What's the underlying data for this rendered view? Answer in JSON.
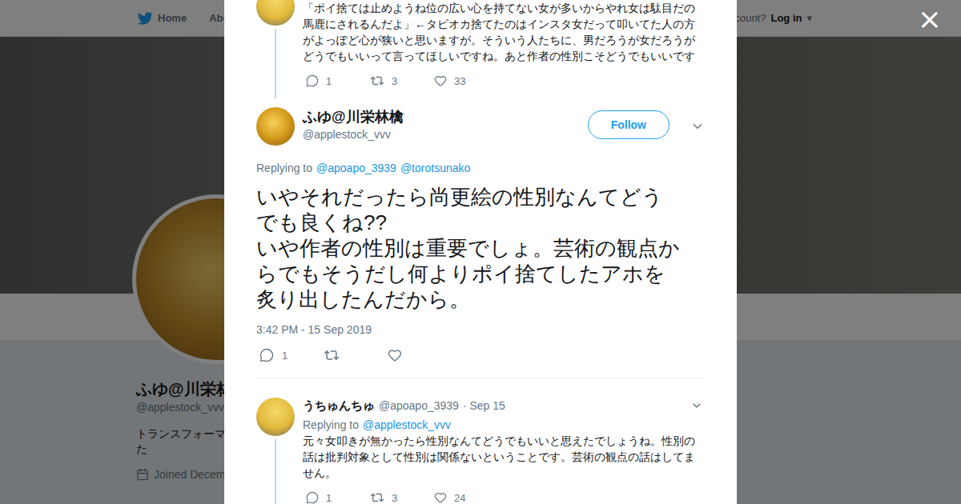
{
  "nav": {
    "items": [
      "Home",
      "Abo"
    ],
    "account": "ccount?",
    "login": "Log in",
    "login_caret": "▾"
  },
  "close": "×",
  "profile": {
    "name": "ふゆ@川栄林",
    "handle": "@applestock_vvv",
    "bio": [
      "トランスフォーマ",
      "た"
    ],
    "joined": "Joined Decem"
  },
  "tweets": [
    {
      "kind": "context",
      "thread": true,
      "text": [
        "「ポイ捨ては止めようね位の広い心を持てない女が多いからやれ女は駄目だの",
        "馬鹿にされるんだよ」←タピオカ捨てたのはインスタ女だって叩いてた人の方",
        "がよっぽど心が狭いと思いますが。そういう人たちに、男だろうが女だろうが",
        "どうでもいいって言ってほしいですね。あと作者の性別こそどうでもいいです"
      ],
      "replies": "1",
      "retweets": "3",
      "likes": "33"
    },
    {
      "kind": "focus",
      "thread": false,
      "name": "ふゆ@川栄林檎",
      "handle": "@applestock_vvv",
      "follow": "Follow",
      "replying_label": "Replying to",
      "replying_to": [
        "@apoapo_3939",
        "@torotsunako"
      ],
      "text": [
        "いやそれだったら尚更絵の性別なんてどう",
        "でも良くね??",
        "いや作者の性別は重要でしょ。芸術の観点か",
        "らでもそうだし何よりポイ捨てしたアホを",
        "炙り出したんだから。"
      ],
      "timestamp": "3:42 PM - 15 Sep 2019",
      "replies": "1",
      "retweets": "",
      "likes": ""
    },
    {
      "kind": "context",
      "thread": true,
      "name": "うちゅんちゅ",
      "handle": "@apoapo_3939",
      "date": "· Sep 15",
      "replying_label": "Replying to",
      "replying_to": [
        "@applestock_vvv"
      ],
      "text": [
        "元々女叩きが無かったら性別なんてどうでもいいと思えたでしょうね。性別の",
        "話は批判対象として性別は関係ないということです。芸術の観点の話はしてま",
        "せん。"
      ],
      "replies": "1",
      "retweets": "3",
      "likes": "24"
    }
  ]
}
